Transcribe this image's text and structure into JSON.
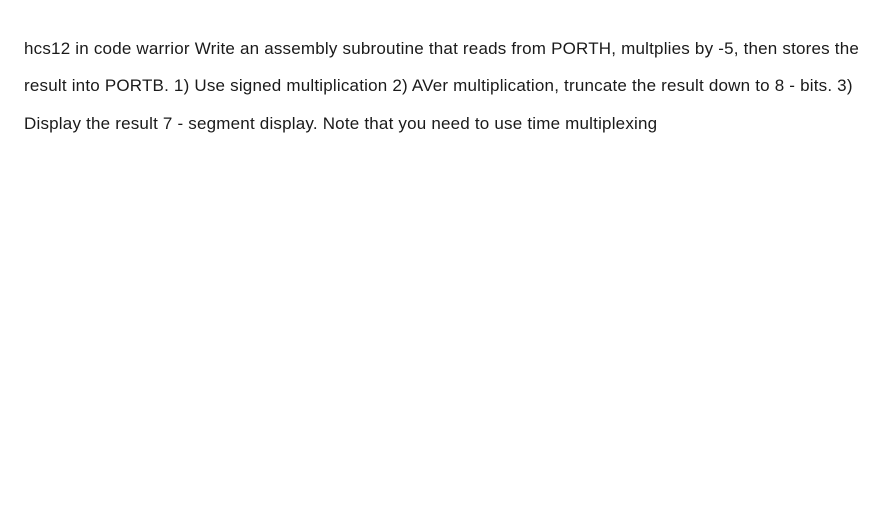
{
  "question": {
    "text": "hcs12 in code warrior Write an assembly subroutine that reads from PORTH, multplies by -5, then stores the result into PORTB. 1) Use signed multiplication 2) AVer multiplication, truncate the result down to 8 - bits. 3) Display the result 7 - segment display. Note that you need to use time multiplexing"
  }
}
